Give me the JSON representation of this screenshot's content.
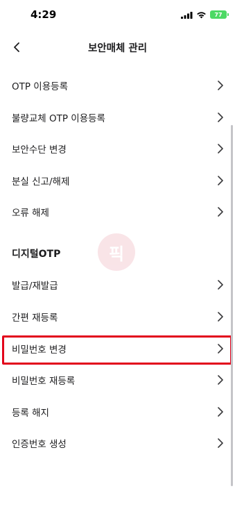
{
  "status_bar": {
    "time": "4:29",
    "battery": "77"
  },
  "header": {
    "title": "보안매체 관리"
  },
  "menu_items": [
    {
      "label": "OTP 이용등록"
    },
    {
      "label": "불량교체 OTP 이용등록"
    },
    {
      "label": "보안수단 변경"
    },
    {
      "label": "분실 신고/해제"
    },
    {
      "label": "오류 해제"
    }
  ],
  "digital_otp": {
    "section_title": "디지털OTP",
    "items": [
      {
        "label": "발급/재발급"
      },
      {
        "label": "간편 재등록"
      },
      {
        "label": "비밀번호 변경",
        "highlighted": true
      },
      {
        "label": "비밀번호 재등록"
      },
      {
        "label": "등록 해지"
      },
      {
        "label": "인증번호 생성"
      }
    ]
  },
  "watermark": {
    "text": "픽"
  },
  "colors": {
    "highlight": "#e2001a",
    "battery": "#4cd964"
  }
}
